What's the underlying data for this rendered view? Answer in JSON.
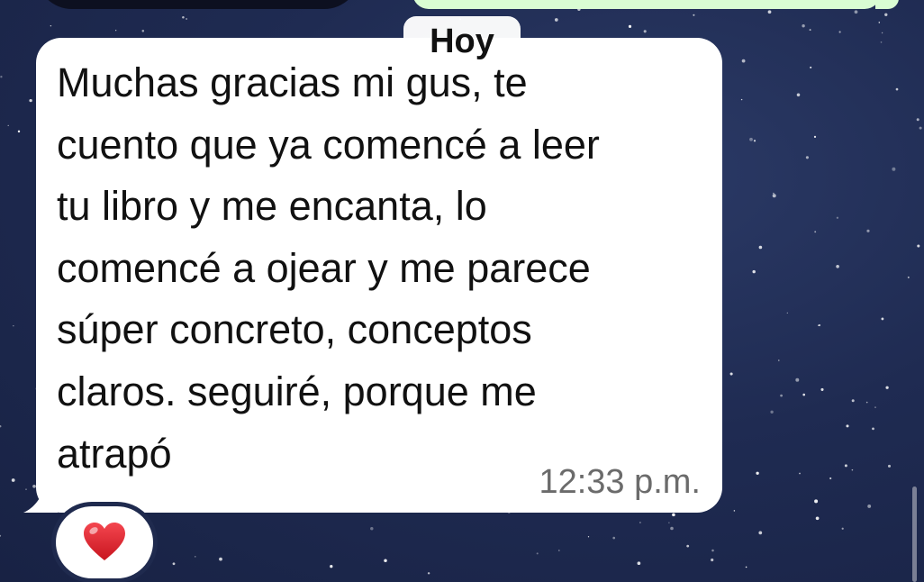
{
  "chat": {
    "date_separator": "Hoy",
    "message": {
      "text": "Muchas gracias mi gus, te\ncuento que ya comencé a leer\ntu libro y me encanta, lo\ncomencé a ojear y me parece\nsúper  concreto, conceptos\nclaros. seguiré, porque me\natrapó",
      "time": "12:33 p.m.",
      "reaction": "heart-icon"
    }
  },
  "colors": {
    "wallpaper": "#1f2a4e",
    "incoming_bubble": "#ffffff",
    "outgoing_bubble": "#d9fdd3",
    "reaction_heart": "#e0242f"
  }
}
